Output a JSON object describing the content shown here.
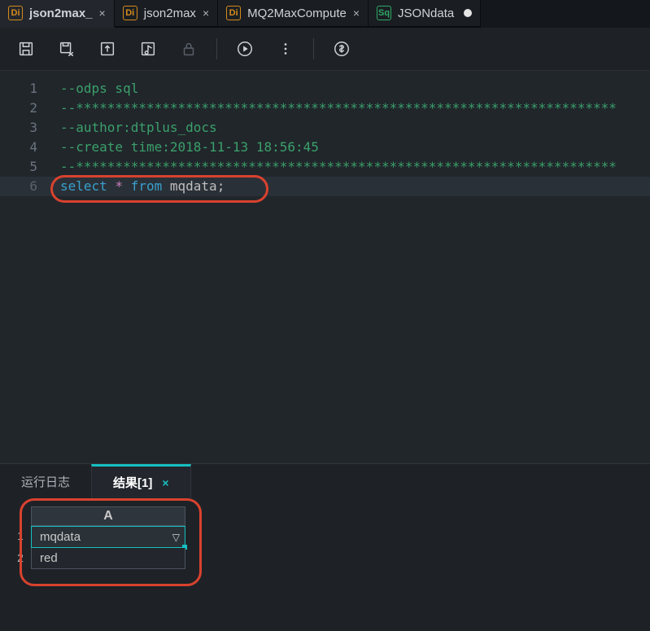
{
  "tabs": [
    {
      "icon": "Di",
      "label": "json2max_",
      "closable": true,
      "active": true
    },
    {
      "icon": "Di",
      "label": "json2max",
      "closable": true,
      "active": false
    },
    {
      "icon": "Di",
      "label": "MQ2MaxCompute",
      "closable": true,
      "active": false
    },
    {
      "icon": "Sq",
      "label": "JSONdata",
      "closable": false,
      "dirty": true,
      "active": false
    }
  ],
  "toolbar_names": [
    "save",
    "save-as",
    "upload",
    "format-sql",
    "lock",
    "run",
    "more",
    "cost"
  ],
  "code": {
    "line1": "--odps sql",
    "line2": "--*********************************************************************",
    "line3": "--author:dtplus_docs",
    "line4": "--create time:2018-11-13 18:56:45",
    "line5": "--*********************************************************************",
    "line6": {
      "kw1": "select",
      "op": "*",
      "kw2": "from",
      "id": "mqdata",
      "punc": ";"
    }
  },
  "line_numbers": [
    "1",
    "2",
    "3",
    "4",
    "5",
    "6"
  ],
  "panel": {
    "tab_log": "运行日志",
    "tab_result": "结果[1]"
  },
  "grid": {
    "col_header": "A",
    "rows": [
      {
        "num": "1",
        "value": "mqdata",
        "dropdown": true,
        "selected": true
      },
      {
        "num": "2",
        "value": "red",
        "dropdown": false,
        "selected": false
      }
    ]
  },
  "colors": {
    "accent": "#15c0c0",
    "highlight": "#d9422e",
    "comment": "#3aa06a",
    "keyword": "#39a0cc",
    "operator": "#c97fbf"
  }
}
